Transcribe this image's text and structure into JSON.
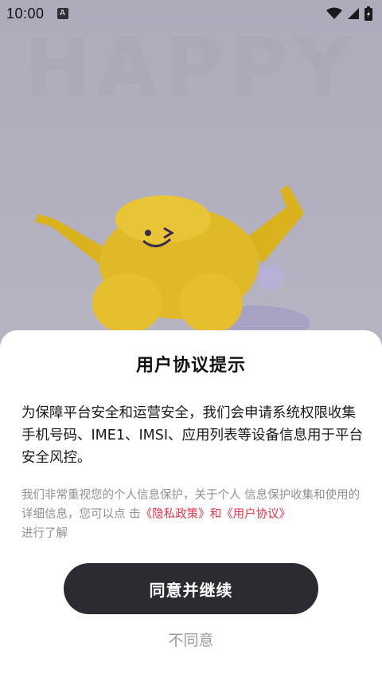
{
  "status_bar": {
    "time": "10:00",
    "notification_icon": "a-box-icon",
    "icons": [
      "wifi-icon",
      "signal-icon",
      "battery-icon"
    ]
  },
  "background": {
    "watermark_text": "HAPPY"
  },
  "dialog": {
    "title": "用户协议提示",
    "body": "为保障平台安全和运营安全，我们会申请系统权限收集手机号码、IME1、IMSI、应用列表等设备信息用于平台安全风控。",
    "note_prefix": "我们非常重视您的个人信息保护，关于个人 信息保护收集和使用的详细信息，您可以点 击",
    "privacy_link": "《隐私政策》",
    "connector": "和",
    "user_agreement_link": "《用户协议》",
    "note_suffix": "进行了解",
    "agree_label": "同意并继续",
    "disagree_label": "不同意"
  },
  "colors": {
    "link": "#e8334a",
    "primary_button": "#2b2c31"
  }
}
